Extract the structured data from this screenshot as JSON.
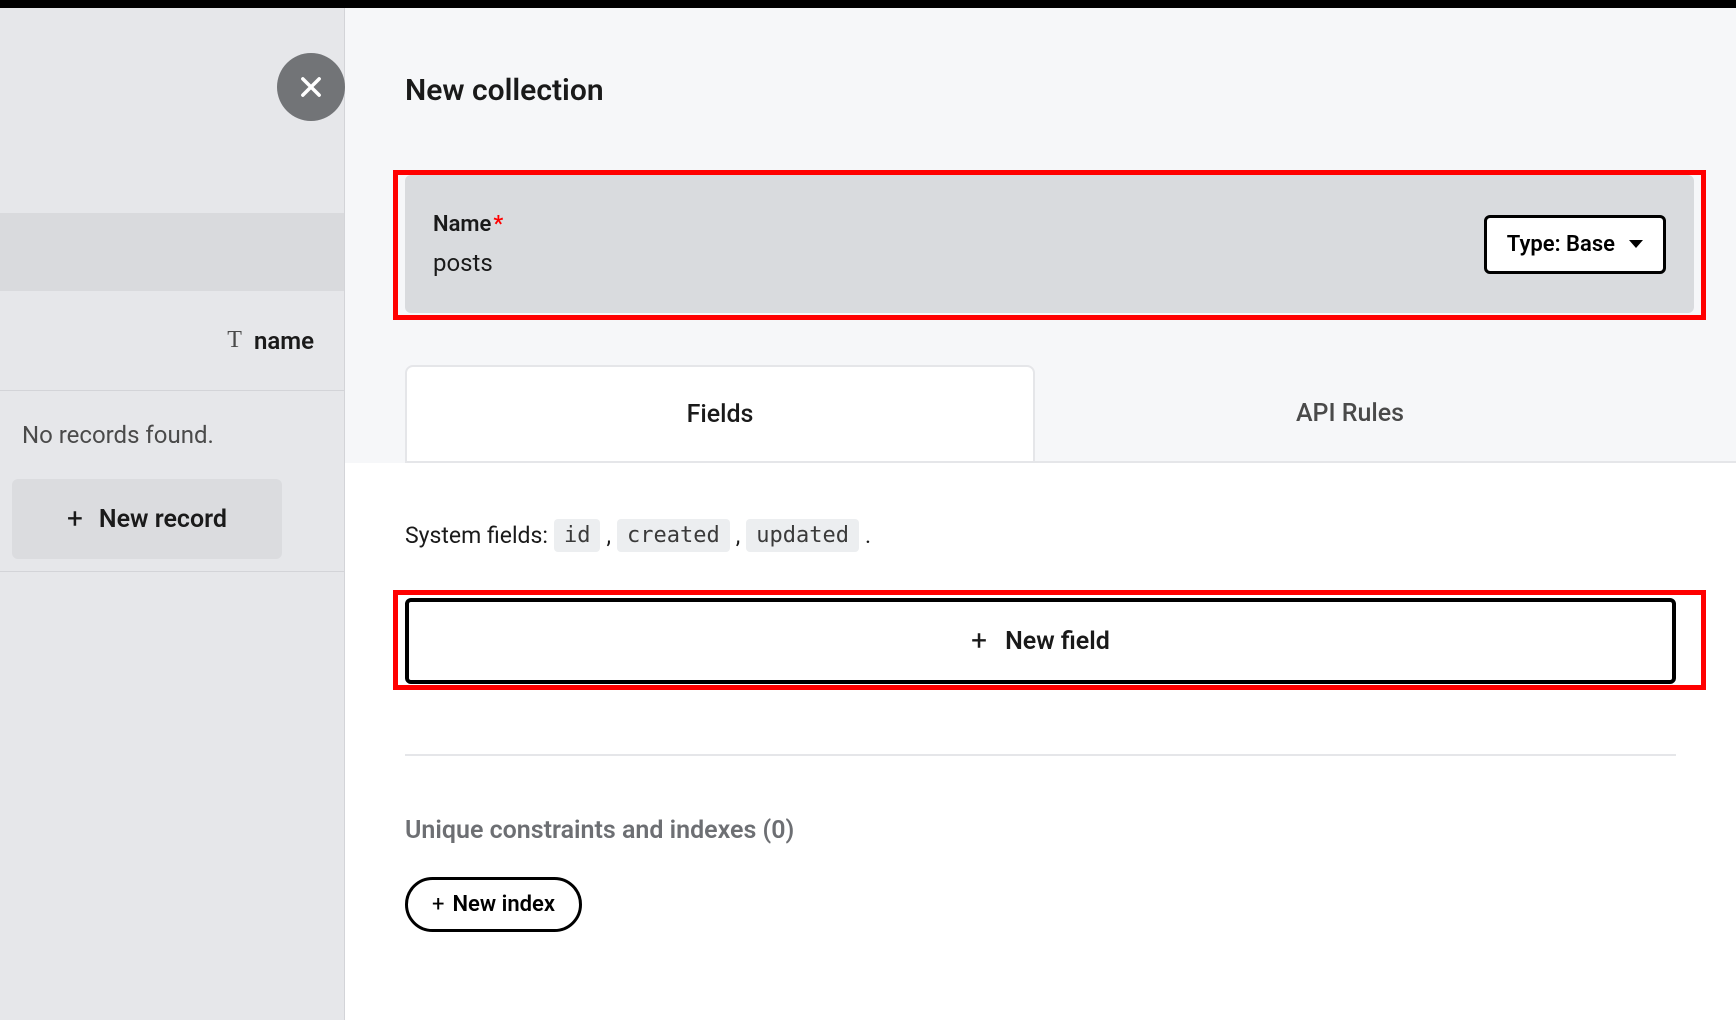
{
  "sidebar": {
    "column_header": "name",
    "no_records": "No records found.",
    "new_record": "New record"
  },
  "panel": {
    "title": "New collection",
    "name_label": "Name",
    "name_value": "posts",
    "type_label": "Type: Base"
  },
  "tabs": {
    "fields": "Fields",
    "api_rules": "API Rules"
  },
  "fields": {
    "system_fields_label": "System fields:",
    "system_fields": [
      "id",
      "created",
      "updated"
    ],
    "new_field": "New field"
  },
  "constraints": {
    "heading": "Unique constraints and indexes (0)",
    "new_index": "New index"
  }
}
